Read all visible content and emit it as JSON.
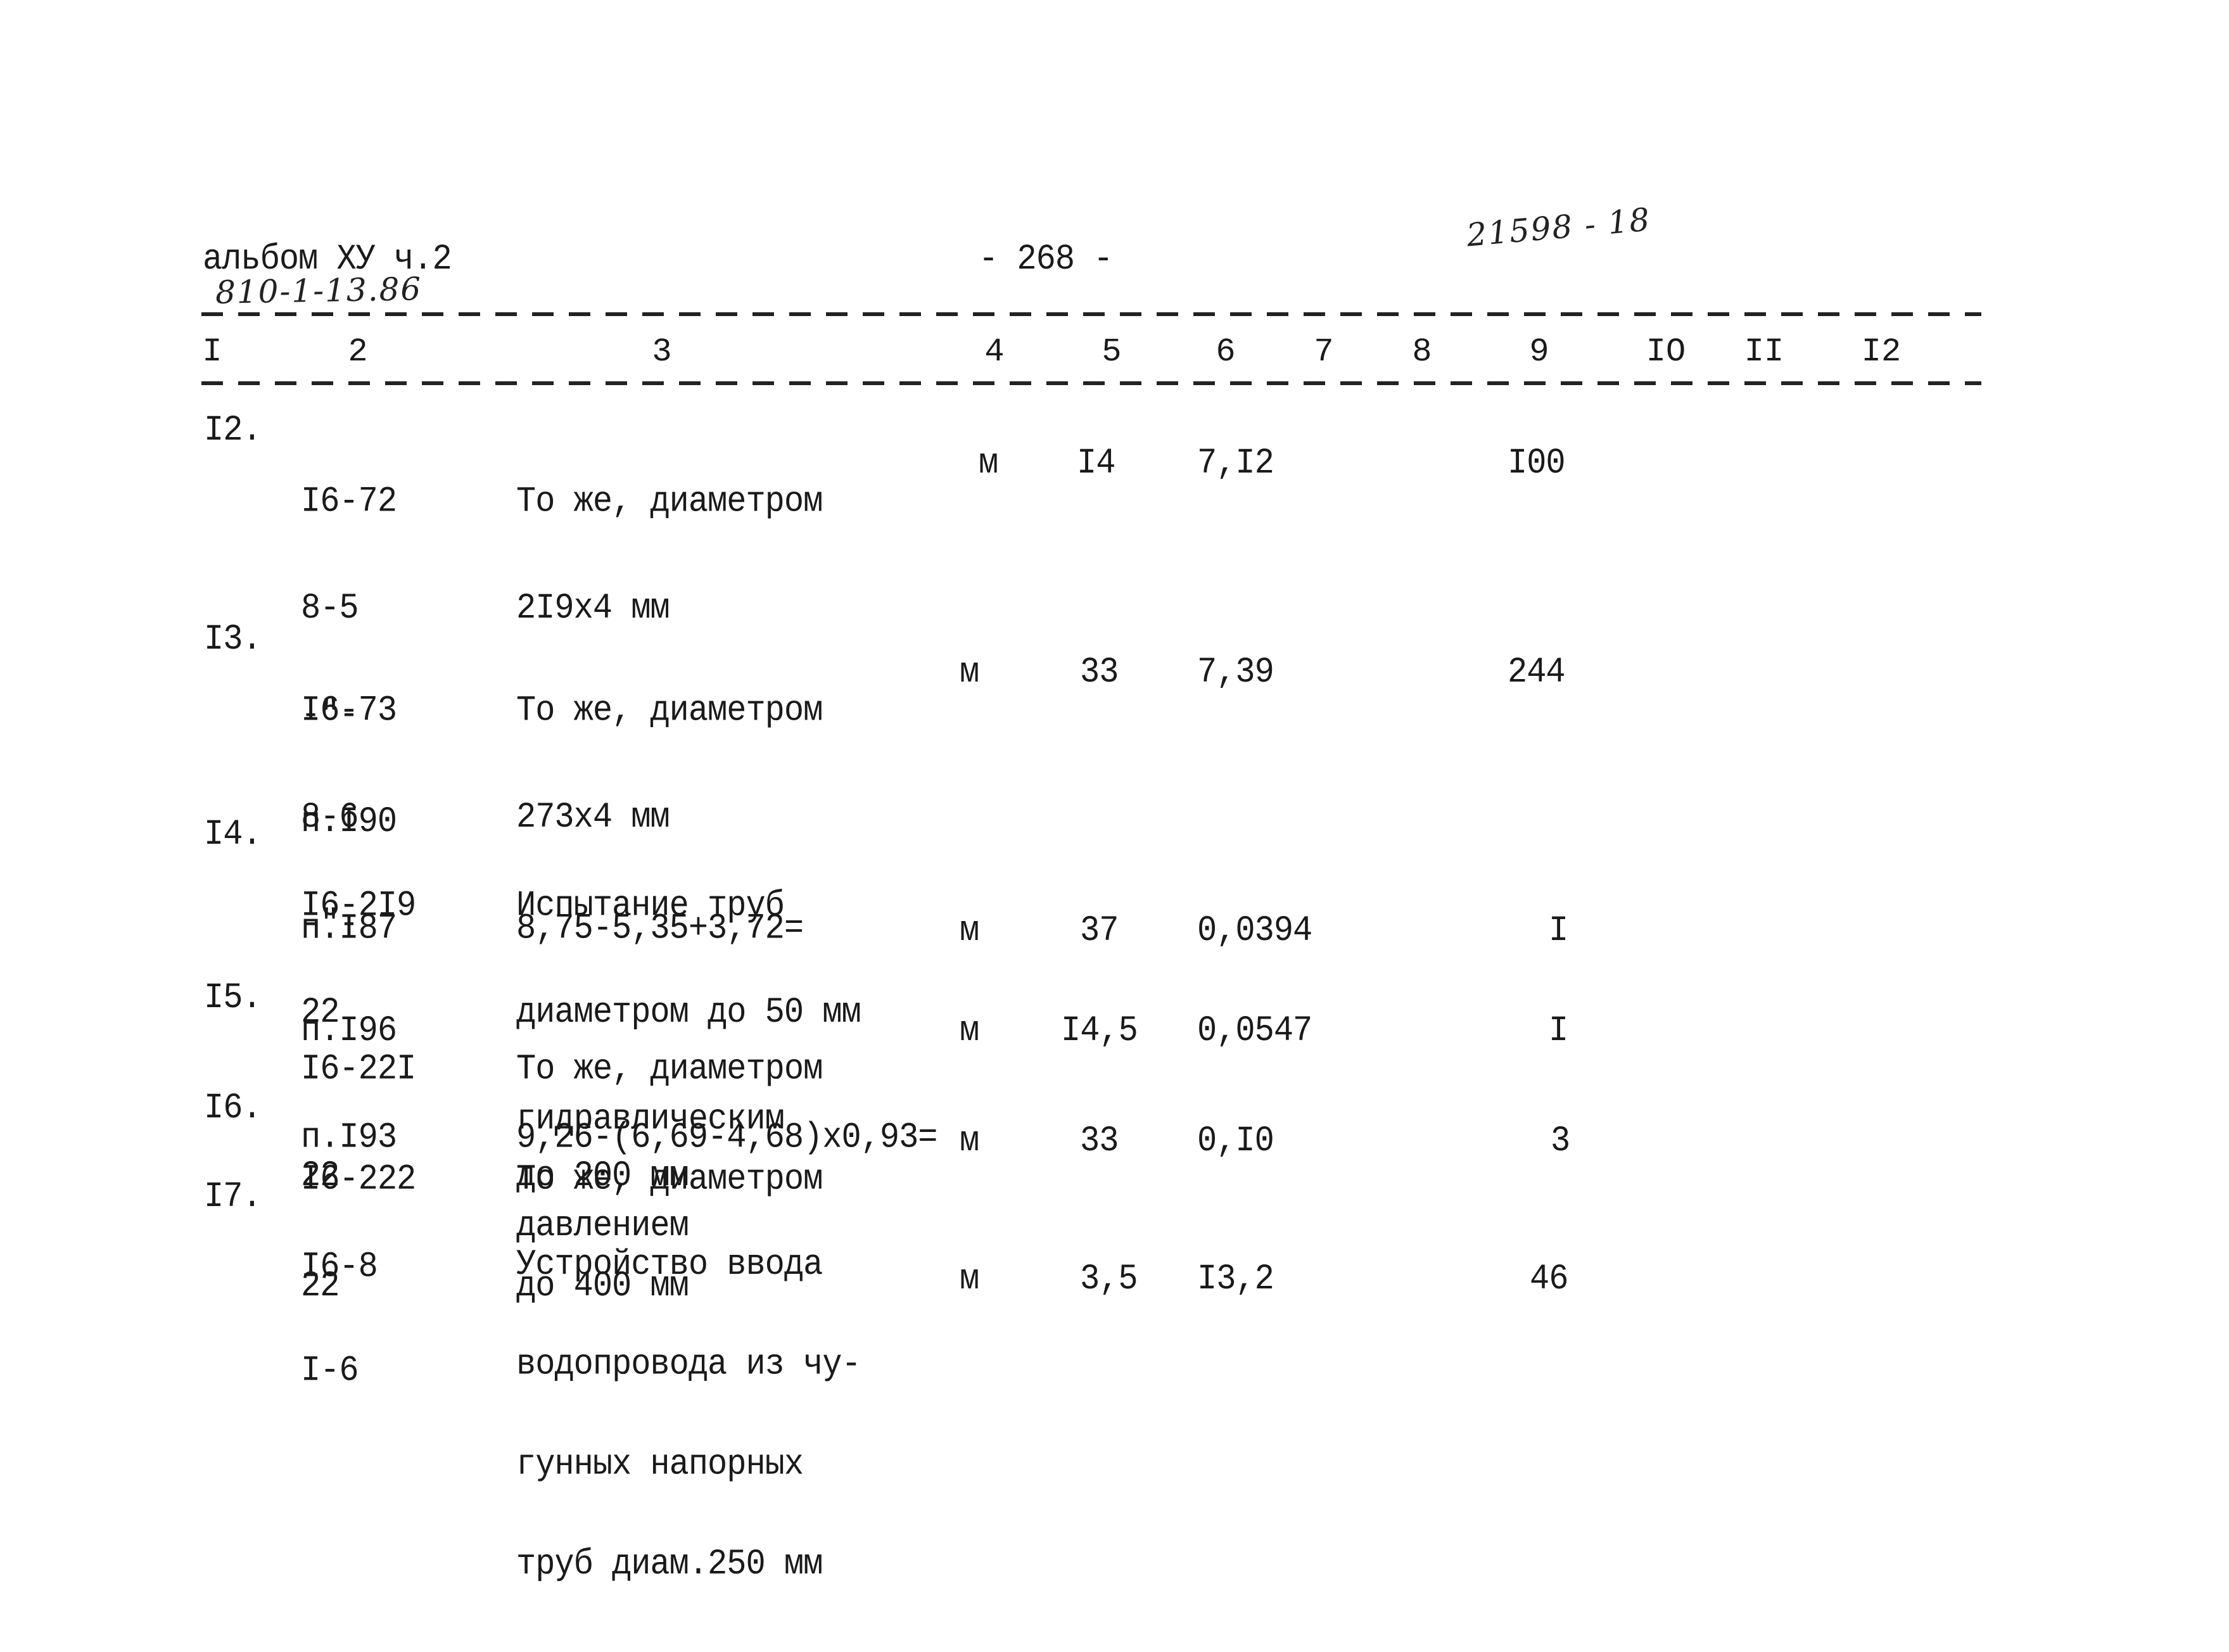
{
  "header": {
    "album": "альбом ХУ ч.2",
    "project_code": "810-1-13.86",
    "page_number": "- 268 -",
    "stamp": "21598 - 18"
  },
  "columns": [
    "I",
    "2",
    "3",
    "4",
    "5",
    "6",
    "7",
    "8",
    "9",
    "IO",
    "II",
    "I2"
  ],
  "rows": [
    {
      "no": "I2.",
      "code": [
        "I6-72",
        "8-5",
        "-\"-",
        "п.I90",
        "п.I87"
      ],
      "desc": [
        "То же, диаметром",
        "2I9x4 мм",
        "",
        "",
        "8,75-5,35+3,72="
      ],
      "unit": "м",
      "qty": "I4",
      "price": "7,I2",
      "total": "I00"
    },
    {
      "no": "I3.",
      "code": [
        "I6-73",
        "8-6",
        "-\"-",
        "п.I96",
        "п.I93"
      ],
      "desc": [
        "То же, диаметром",
        "273x4 мм",
        "",
        "",
        "9,26-(6,69-4,68)x0,93="
      ],
      "unit": "м",
      "qty": "33",
      "price": "7,39",
      "total": "244"
    },
    {
      "no": "I4.",
      "code": [
        "I6-2I9",
        "22"
      ],
      "desc": [
        "Испытание труб",
        "диаметром до 50 мм",
        "гидравлическим",
        "давлением"
      ],
      "unit": "м",
      "qty": "37",
      "price": "0,0394",
      "total": "I"
    },
    {
      "no": "I5.",
      "code": [
        "I6-22I",
        "22"
      ],
      "desc": [
        "То же, диаметром",
        "до 200 мм"
      ],
      "unit": "м",
      "qty": "I4,5",
      "price": "0,0547",
      "total": "I"
    },
    {
      "no": "I6.",
      "code": [
        "I6-222",
        "22"
      ],
      "desc": [
        "То же, диаметром",
        "до 400 мм"
      ],
      "unit": "м",
      "qty": "33",
      "price": "0,I0",
      "total": "3"
    },
    {
      "no": "I7.",
      "code": [
        "I6-8",
        "I-6"
      ],
      "desc": [
        "Устройство ввода",
        "водопровода из чу-",
        "гунных напорных",
        "труб диам.250 мм"
      ],
      "unit": "м",
      "qty": "3,5",
      "price": "I3,2",
      "total": "46"
    }
  ]
}
